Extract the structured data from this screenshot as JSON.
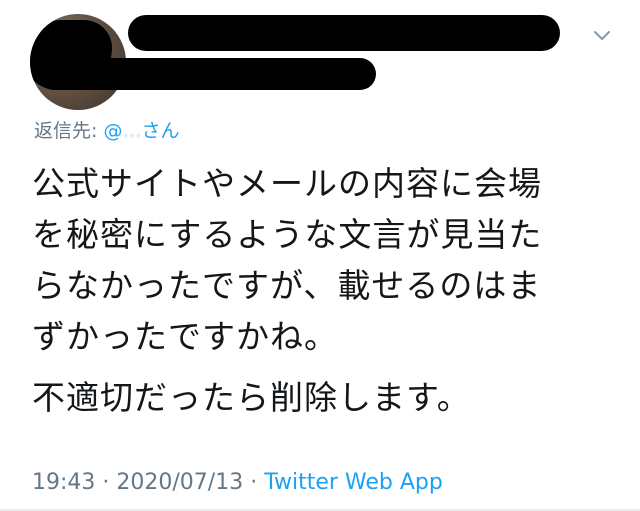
{
  "tweet": {
    "reply_prefix": "返信先: ",
    "reply_handle_visible": "@",
    "reply_handle_obscured": "…",
    "reply_suffix": "さん",
    "text_lines_p1": [
      "公式サイトやメールの内容に会場",
      "を秘密にするような文言が見当た",
      "らなかったですが、載せるのはま",
      "ずかったですかね。"
    ],
    "text_p2": "不適切だったら削除します。",
    "time": "19:43",
    "separator": " · ",
    "date": "2020/07/13",
    "source": "Twitter Web App"
  },
  "icons": {
    "menu": "chevron-down-icon"
  },
  "colors": {
    "text": "#14171a",
    "secondary": "#657786",
    "link": "#1da1f2"
  }
}
